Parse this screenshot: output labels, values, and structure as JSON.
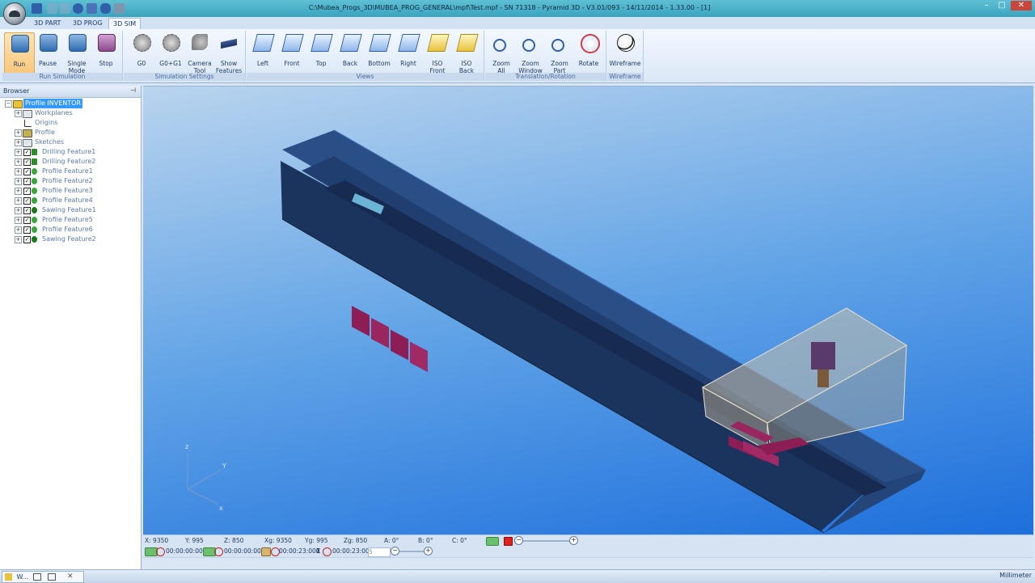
{
  "window": {
    "title": "C:\\Mubea_Progs_3D\\MUBEA_PROG_GENERAL\\mpf\\Test.mpf - SN 71318 - Pyramid 3D - V3.01/093 - 14/11/2014 - 1.33.00 - [1]",
    "minimize": "–",
    "maximize": "□",
    "close": "✕"
  },
  "tabs": [
    {
      "label": "3D PART"
    },
    {
      "label": "3D PROG"
    },
    {
      "label": "3D SIM"
    }
  ],
  "ribbon": {
    "groups": [
      {
        "label": "Run Simulation",
        "buttons": [
          {
            "label": "Run",
            "icon": "run-icon"
          },
          {
            "label": "Pause",
            "icon": "pause-icon"
          },
          {
            "label": "Single\nMode",
            "icon": "single-mode-icon"
          },
          {
            "label": "Stop",
            "icon": "stop-icon"
          }
        ]
      },
      {
        "label": "Simulation Settings",
        "buttons": [
          {
            "label": "G0",
            "icon": "g0-icon"
          },
          {
            "label": "G0+G1",
            "icon": "g0-g1-icon"
          },
          {
            "label": "Camera\nTool",
            "icon": "camera-tool-icon"
          },
          {
            "label": "Show\nFeatures",
            "icon": "show-features-icon"
          }
        ]
      },
      {
        "label": "Views",
        "buttons": [
          {
            "label": "Left",
            "icon": "view-left-icon"
          },
          {
            "label": "Front",
            "icon": "view-front-icon"
          },
          {
            "label": "Top",
            "icon": "view-top-icon"
          },
          {
            "label": "Back",
            "icon": "view-back-icon"
          },
          {
            "label": "Bottom",
            "icon": "view-bottom-icon"
          },
          {
            "label": "Right",
            "icon": "view-right-icon"
          },
          {
            "label": "ISO\nFront",
            "icon": "iso-front-icon"
          },
          {
            "label": "ISO\nBack",
            "icon": "iso-back-icon"
          }
        ]
      },
      {
        "label": "Translation/Rotation",
        "buttons": [
          {
            "label": "Zoom\nAll",
            "icon": "zoom-all-icon"
          },
          {
            "label": "Zoom\nWindow",
            "icon": "zoom-window-icon"
          },
          {
            "label": "Zoom\nPart",
            "icon": "zoom-part-icon"
          },
          {
            "label": "Rotate",
            "icon": "rotate-icon"
          }
        ]
      },
      {
        "label": "Wireframe",
        "buttons": [
          {
            "label": "Wireframe",
            "icon": "wireframe-icon"
          }
        ]
      }
    ]
  },
  "browser": {
    "title": "Browser",
    "pin": "⊣",
    "tree": [
      {
        "label": "Profile INVENTOR",
        "selected": true
      },
      {
        "label": "Workplanes"
      },
      {
        "label": "Origins"
      },
      {
        "label": "Profile"
      },
      {
        "label": "Sketches"
      },
      {
        "label": "Drilling Feature1",
        "checked": true
      },
      {
        "label": "Drilling Feature2",
        "checked": true
      },
      {
        "label": "Profile Feature1",
        "checked": true
      },
      {
        "label": "Profile Feature2",
        "checked": true
      },
      {
        "label": "Profile Feature3",
        "checked": true
      },
      {
        "label": "Profile Feature4",
        "checked": true
      },
      {
        "label": "Sawing Feature1",
        "checked": true
      },
      {
        "label": "Profile Feature5",
        "checked": true
      },
      {
        "label": "Profile Feature6",
        "checked": true
      },
      {
        "label": "Sawing Feature2",
        "checked": true
      }
    ]
  },
  "viewport": {
    "axis": {
      "z": "z",
      "y": "Y",
      "x": "x"
    }
  },
  "coords": [
    {
      "label": "X: 9350"
    },
    {
      "label": "Y: 995"
    },
    {
      "label": "Z: 850"
    },
    {
      "label": "Xg: 9350"
    },
    {
      "label": "Yg: 995"
    },
    {
      "label": "Zg: 850"
    },
    {
      "label": "A: 0°"
    },
    {
      "label": "B: 0°"
    },
    {
      "label": "C: 0°"
    }
  ],
  "timeline": {
    "times": [
      "00:00:00:000",
      "00:00:00:000",
      "00:00:23:000",
      "00:00:23:000"
    ],
    "speed_value": "5"
  },
  "taskbar": {
    "item": "W...",
    "units": "Millimeter"
  }
}
